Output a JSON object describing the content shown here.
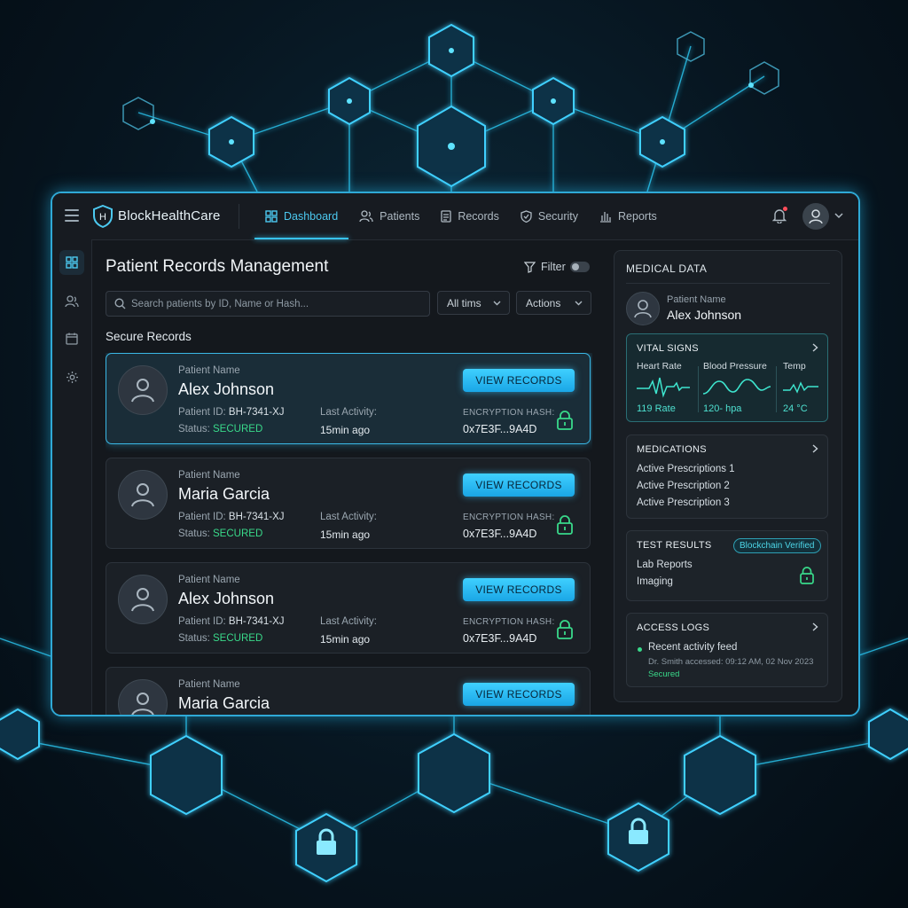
{
  "app": {
    "brand": "BlockHealthCare"
  },
  "nav": {
    "items": [
      {
        "label": "Dashboard",
        "icon": "grid-icon",
        "active": true
      },
      {
        "label": "Patients",
        "icon": "users-icon"
      },
      {
        "label": "Records",
        "icon": "document-icon"
      },
      {
        "label": "Security",
        "icon": "shield-icon"
      },
      {
        "label": "Reports",
        "icon": "bar-chart-icon"
      }
    ]
  },
  "main": {
    "title": "Patient Records Management",
    "filter_label": "Filter",
    "search_placeholder": "Search patients by ID, Name or Hash...",
    "time_filter": "All tims",
    "actions_label": "Actions",
    "section_label": "Secure Records"
  },
  "records": [
    {
      "label": "Patient Name",
      "name": "Alex Johnson",
      "pid_label": "Patient ID:",
      "pid": "BH-7341-XJ",
      "status_label": "Status:",
      "status": "SECURED",
      "activity_label": "Last Activity:",
      "activity": "15min ago",
      "button": "VIEW RECORDS",
      "hash_label": "ENCRYPTION HASH:",
      "hash": "0x7E3F...9A4D"
    },
    {
      "label": "Patient Name",
      "name": "Maria Garcia",
      "pid_label": "Patient ID:",
      "pid": "BH-7341-XJ",
      "status_label": "Status:",
      "status": "SECURED",
      "activity_label": "Last Activity:",
      "activity": "15min ago",
      "button": "VIEW RECORDS",
      "hash_label": "ENCRYPTION HASH:",
      "hash": "0x7E3F...9A4D"
    },
    {
      "label": "Patient Name",
      "name": "Alex Johnson",
      "pid_label": "Patient ID:",
      "pid": "BH-7341-XJ",
      "status_label": "Status:",
      "status": "SECURED",
      "activity_label": "Last Activity:",
      "activity": "15min ago",
      "button": "VIEW RECORDS",
      "hash_label": "ENCRYPTION HASH:",
      "hash": "0x7E3F...9A4D"
    },
    {
      "label": "Patient Name",
      "name": "Maria Garcia",
      "button": "VIEW RECORDS"
    }
  ],
  "medical": {
    "title": "MEDICAL DATA",
    "patient_label": "Patient Name",
    "patient_name": "Alex Johnson",
    "vitals": {
      "title": "VITAL SIGNS",
      "heart_label": "Heart Rate",
      "heart_value": "119 Rate",
      "bp_label": "Blood Pressure",
      "bp_value": "120- hpa",
      "temp_label": "Temp",
      "temp_value": "24 °C"
    },
    "medications": {
      "title": "MEDICATIONS",
      "items": [
        "Active Prescriptions 1",
        "Active Prescription 2",
        "Active Prescription 3"
      ]
    },
    "tests": {
      "title": "TEST RESULTS",
      "badge": "Blockchain Verified",
      "items": [
        "Lab Reports",
        "Imaging"
      ]
    },
    "logs": {
      "title": "ACCESS LOGS",
      "feed": "Recent activity feed",
      "entry": "Dr. Smith accessed: 09:12 AM, 02 Nov 2023",
      "status": "Secured"
    }
  },
  "colors": {
    "accent": "#37c3f0",
    "secured": "#39d98a",
    "background": "#071621",
    "window": "#14181d"
  }
}
